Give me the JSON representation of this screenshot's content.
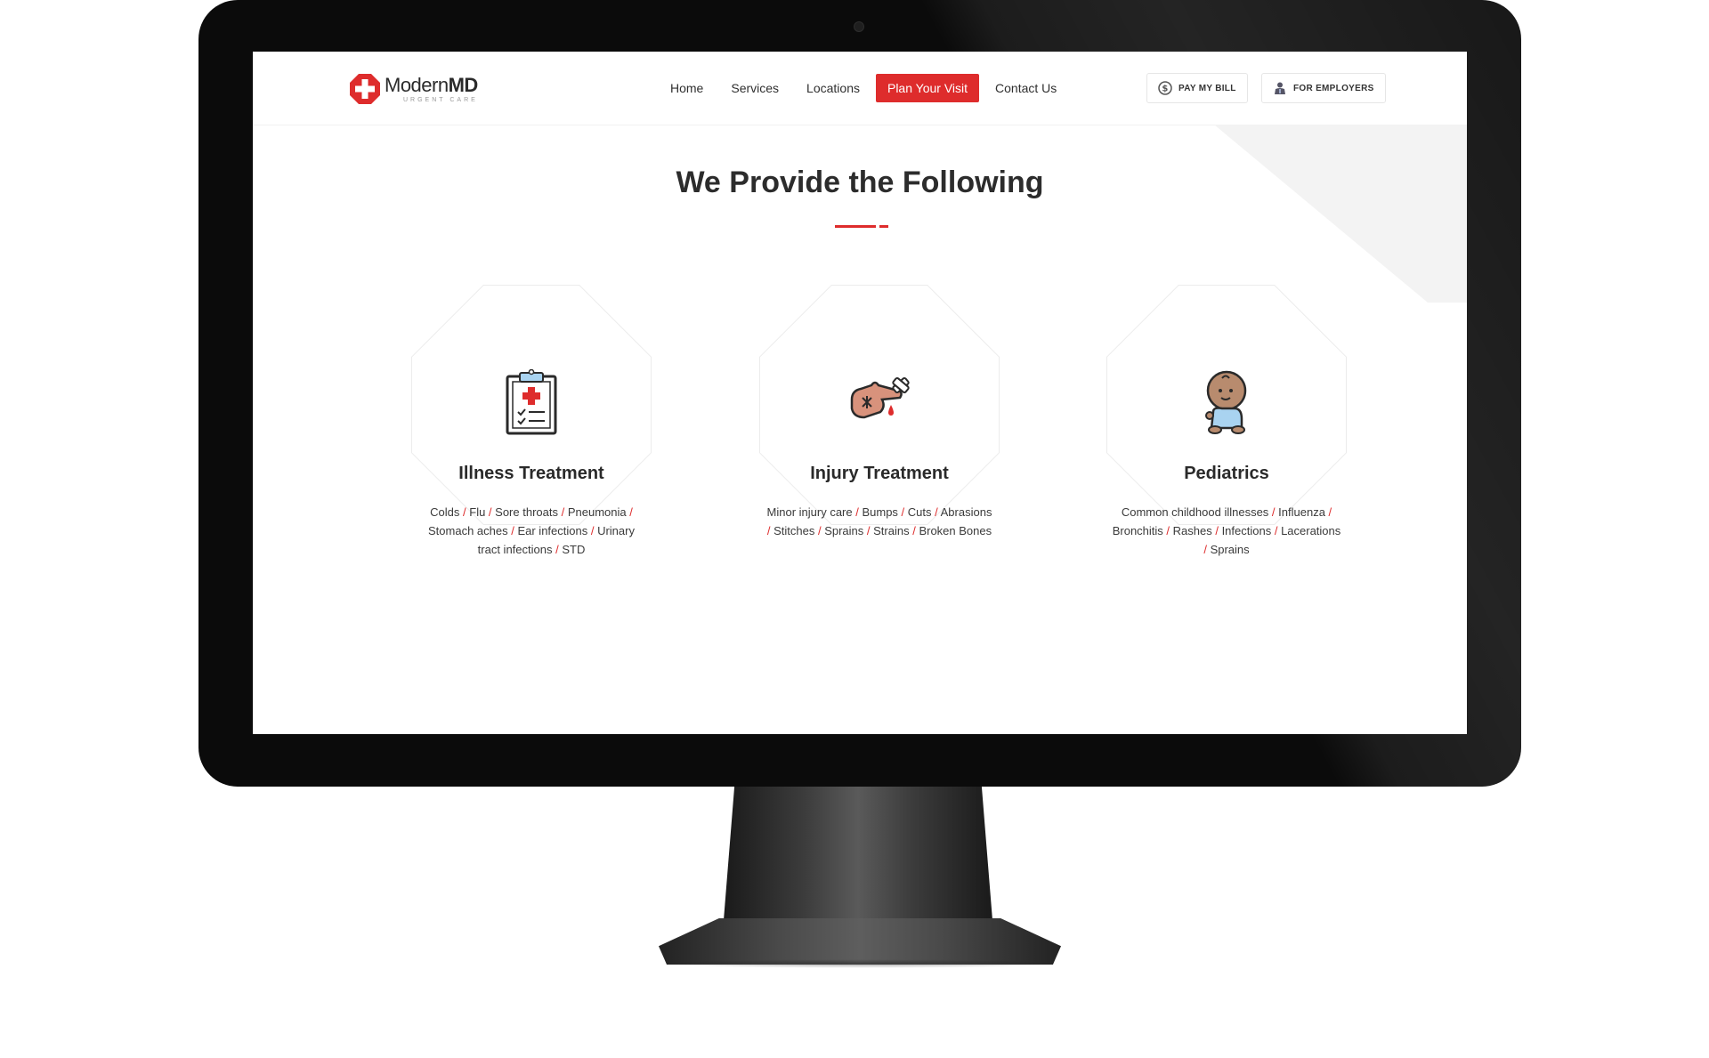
{
  "header": {
    "logo": {
      "main": "Modern",
      "bold": "MD",
      "sub": "URGENT CARE"
    },
    "nav": [
      {
        "label": "Home"
      },
      {
        "label": "Services"
      },
      {
        "label": "Locations"
      },
      {
        "label": "Plan Your Visit",
        "active": true
      },
      {
        "label": "Contact Us"
      }
    ],
    "utility": {
      "pay_bill": {
        "label": "PAY MY BILL",
        "icon": "dollar-circle-icon"
      },
      "employers": {
        "label": "FOR EMPLOYERS",
        "icon": "employer-person-icon"
      }
    }
  },
  "main": {
    "title": "We Provide the Following",
    "services": [
      {
        "title": "Illness Treatment",
        "icon": "clipboard-medical-icon",
        "items": [
          "Colds",
          "Flu",
          "Sore throats",
          "Pneumonia",
          "Stomach aches",
          "Ear infections",
          "Urinary tract infections",
          "STD"
        ]
      },
      {
        "title": "Injury Treatment",
        "icon": "injured-hand-icon",
        "items": [
          "Minor injury care",
          "Bumps",
          "Cuts",
          "Abrasions",
          "Stitches",
          "Sprains",
          "Strains",
          "Broken Bones"
        ]
      },
      {
        "title": "Pediatrics",
        "icon": "baby-icon",
        "items": [
          "Common childhood illnesses",
          "Influenza",
          "Bronchitis",
          "Rashes",
          "Infections",
          "Lacerations",
          "Sprains"
        ]
      }
    ]
  },
  "colors": {
    "accent": "#de2c2c",
    "text": "#2c2c2c",
    "bezel": "#0b0b0b"
  }
}
